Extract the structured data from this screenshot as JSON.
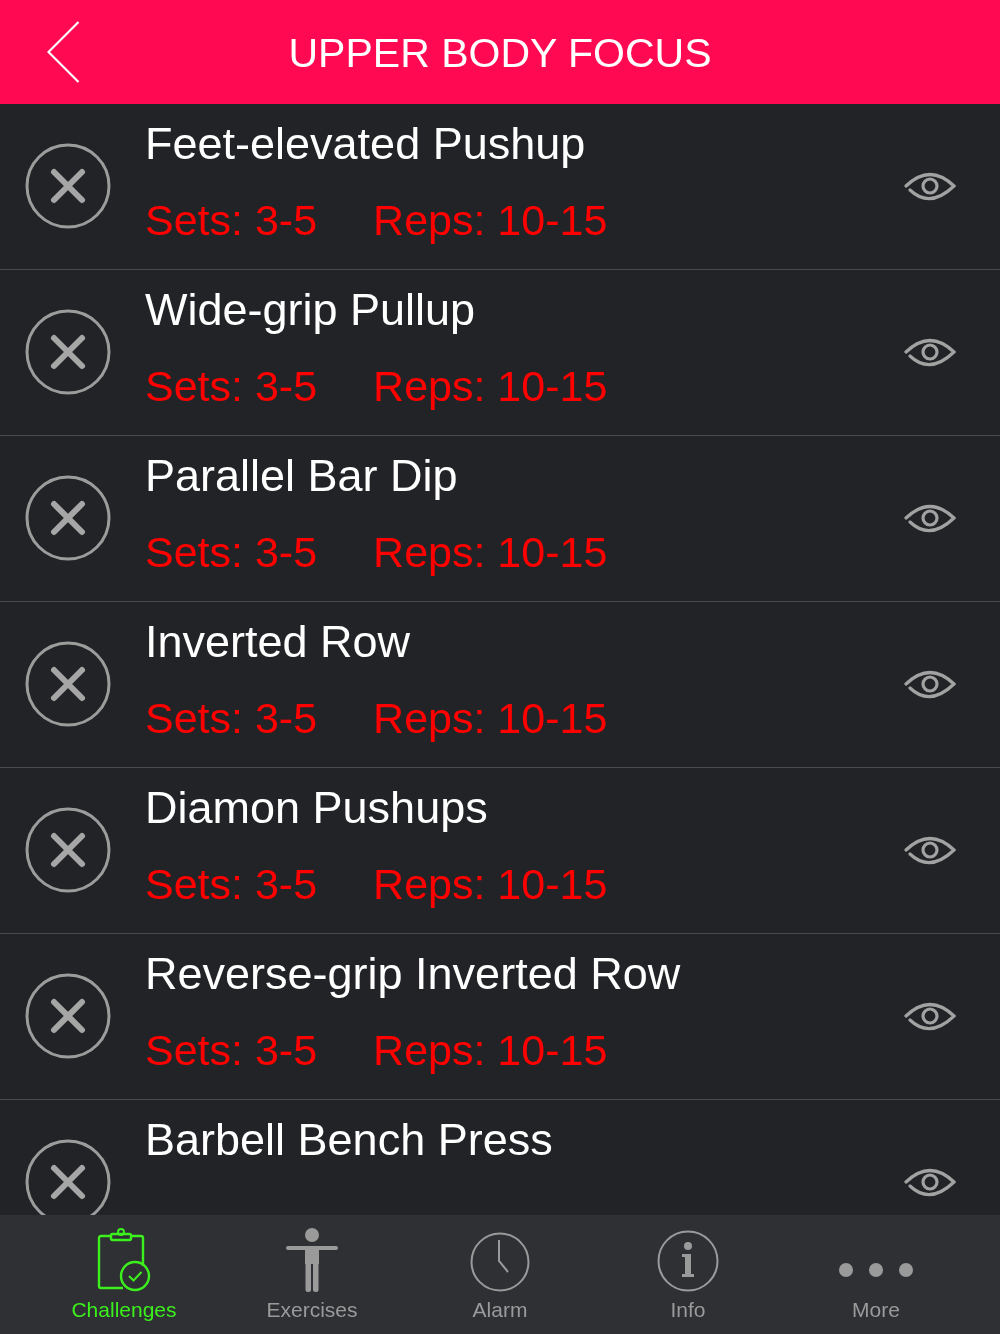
{
  "header": {
    "title": "UPPER BODY FOCUS"
  },
  "exercises": [
    {
      "name": "Feet-elevated Pushup",
      "sets": "Sets: 3-5",
      "reps": "Reps: 10-15"
    },
    {
      "name": "Wide-grip Pullup",
      "sets": "Sets: 3-5",
      "reps": "Reps: 10-15"
    },
    {
      "name": "Parallel Bar Dip",
      "sets": "Sets: 3-5",
      "reps": "Reps: 10-15"
    },
    {
      "name": "Inverted Row",
      "sets": "Sets: 3-5",
      "reps": "Reps: 10-15"
    },
    {
      "name": "Diamon Pushups",
      "sets": "Sets: 3-5",
      "reps": "Reps: 10-15"
    },
    {
      "name": "Reverse-grip Inverted Row",
      "sets": "Sets: 3-5",
      "reps": "Reps: 10-15"
    },
    {
      "name": "Barbell Bench Press"
    }
  ],
  "tab_bar": [
    {
      "label": "Challenges",
      "selected": true
    },
    {
      "label": "Exercises",
      "selected": false
    },
    {
      "label": "Alarm",
      "selected": false
    },
    {
      "label": "Info",
      "selected": false
    },
    {
      "label": "More",
      "selected": false
    }
  ]
}
